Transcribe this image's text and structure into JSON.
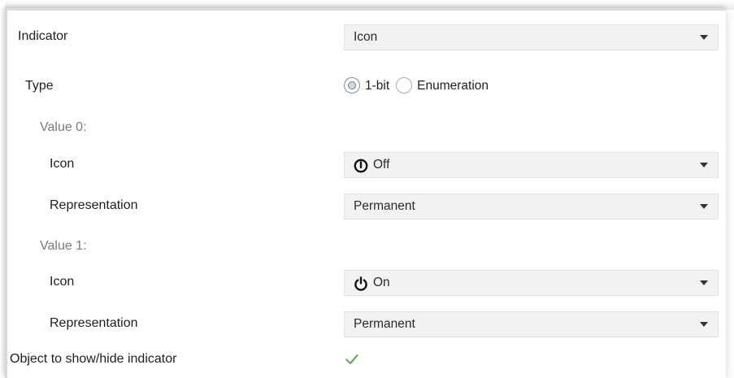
{
  "indicator": {
    "label": "Indicator",
    "value": "Icon"
  },
  "type": {
    "label": "Type",
    "options": [
      {
        "label": "1-bit",
        "checked": true
      },
      {
        "label": "Enumeration",
        "checked": false
      }
    ]
  },
  "value0": {
    "heading": "Value 0:",
    "icon_label": "Icon",
    "icon_value": "Off",
    "icon_glyph": "off-icon",
    "representation_label": "Representation",
    "representation_value": "Permanent"
  },
  "value1": {
    "heading": "Value 1:",
    "icon_label": "Icon",
    "icon_value": "On",
    "icon_glyph": "power-icon",
    "representation_label": "Representation",
    "representation_value": "Permanent"
  },
  "object_show_hide": {
    "label": "Object to show/hide indicator",
    "checked": true
  },
  "colors": {
    "checkmark": "#5fae5f",
    "field_bg": "#f2f2f2",
    "sub_label": "#7a7a7a"
  }
}
